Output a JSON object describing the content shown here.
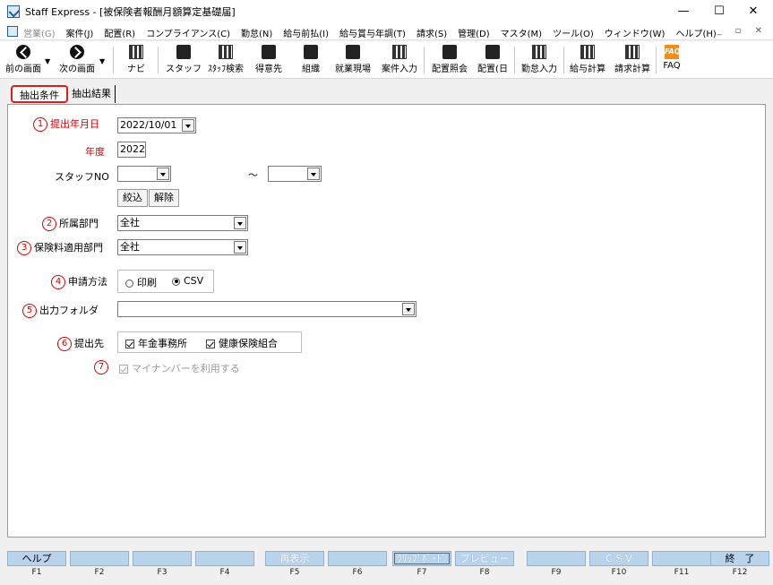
{
  "window": {
    "title": "Staff Express - [被保険者報酬月額算定基礎届]"
  },
  "menu": [
    "営業(G)",
    "案件(J)",
    "配置(R)",
    "コンプライアンス(C)",
    "勤怠(N)",
    "給与前払(I)",
    "給与賞与年調(T)",
    "請求(S)",
    "管理(D)",
    "マスタ(M)",
    "ツール(O)",
    "ウィンドウ(W)",
    "ヘルプ(H)"
  ],
  "toolbar": {
    "prev": "前の画面",
    "next": "次の画面",
    "navi": "ナビ",
    "staff": "スタッフ",
    "staff_search": "ｽﾀｯﾌ検索",
    "client": "得意先",
    "org": "組織",
    "site": "就業現場",
    "case_input": "案件入力",
    "assign_view": "配置照会",
    "assign_day": "配置(日",
    "attendance": "勤怠入力",
    "payroll": "給与計算",
    "billing": "請求計算",
    "faq": "FAQ",
    "faq_icon": "FAQ"
  },
  "tabs": {
    "conditions": "抽出条件",
    "results": "抽出結果"
  },
  "form": {
    "n1": "1",
    "n2": "2",
    "n3": "3",
    "n4": "4",
    "n5": "5",
    "n6": "6",
    "n7": "7",
    "submit_date_label": "提出年月日",
    "submit_date": "2022/10/01",
    "fiscal_year_label": "年度",
    "fiscal_year": "2022",
    "staff_no_label": "スタッフNO",
    "staff_no_from": "",
    "staff_no_to": "",
    "tilde": "～",
    "filter_btn": "絞込",
    "clear_btn": "解除",
    "dept_label": "所属部門",
    "dept": "全社",
    "ins_dept_label": "保険料適用部門",
    "ins_dept": "全社",
    "method_label": "申請方法",
    "method_print": "印刷",
    "method_csv": "CSV",
    "folder_label": "出力フォルダ",
    "folder": "",
    "dest_label": "提出先",
    "dest_pension": "年金事務所",
    "dest_health": "健康保険組合",
    "mynumber": "マイナンバーを利用する"
  },
  "fkeys": [
    {
      "label": "ヘルプ",
      "key": "F1"
    },
    {
      "label": "",
      "key": "F2"
    },
    {
      "label": "",
      "key": "F3"
    },
    {
      "label": "",
      "key": "F4"
    },
    {
      "label": "再表示",
      "key": "F5"
    },
    {
      "label": "",
      "key": "F6"
    },
    {
      "label": "ｸﾘｯﾌﾟﾎﾞｰﾄﾞ",
      "key": "F7"
    },
    {
      "label": "プレビュー",
      "key": "F8"
    },
    {
      "label": "",
      "key": "F9"
    },
    {
      "label": "ＣＳＶ",
      "key": "F10"
    },
    {
      "label": "",
      "key": "F11"
    },
    {
      "label": "終　了",
      "key": "F12"
    }
  ]
}
